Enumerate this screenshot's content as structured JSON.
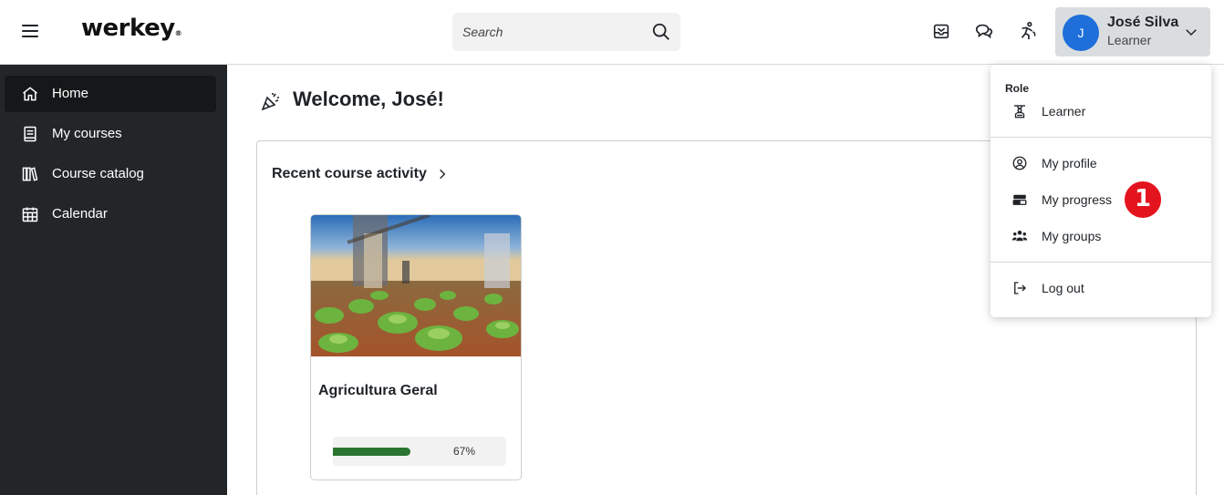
{
  "header": {
    "logo_text": "werkey",
    "logo_mark": "®",
    "search_placeholder": "Search",
    "icons": [
      "menu-icon",
      "inbox-icon",
      "chat-icon",
      "accessibility-icon",
      "chevron-down-icon"
    ]
  },
  "user": {
    "initial": "J",
    "name": "José Silva",
    "role": "Learner",
    "avatar_color": "#1e6fd9"
  },
  "sidebar": {
    "items": [
      {
        "label": "Home",
        "icon": "home-icon",
        "active": true
      },
      {
        "label": "My courses",
        "icon": "book-icon",
        "active": false
      },
      {
        "label": "Course catalog",
        "icon": "library-icon",
        "active": false
      },
      {
        "label": "Calendar",
        "icon": "calendar-icon",
        "active": false
      }
    ]
  },
  "main": {
    "welcome": "Welcome, José!",
    "recent_title": "Recent course activity",
    "courses": [
      {
        "name": "Agricultura Geral",
        "progress_label": "67%",
        "progress": 67
      }
    ]
  },
  "dropdown": {
    "role_title": "Role",
    "role_item": "Learner",
    "items": [
      "My profile",
      "My progress",
      "My groups"
    ],
    "logout": "Log out"
  },
  "annotation": {
    "badge": "1",
    "badge_color": "#e4141f"
  },
  "colors": {
    "sidebar_bg": "#232629",
    "sidebar_active": "#151719",
    "progress": "#2a7530"
  }
}
